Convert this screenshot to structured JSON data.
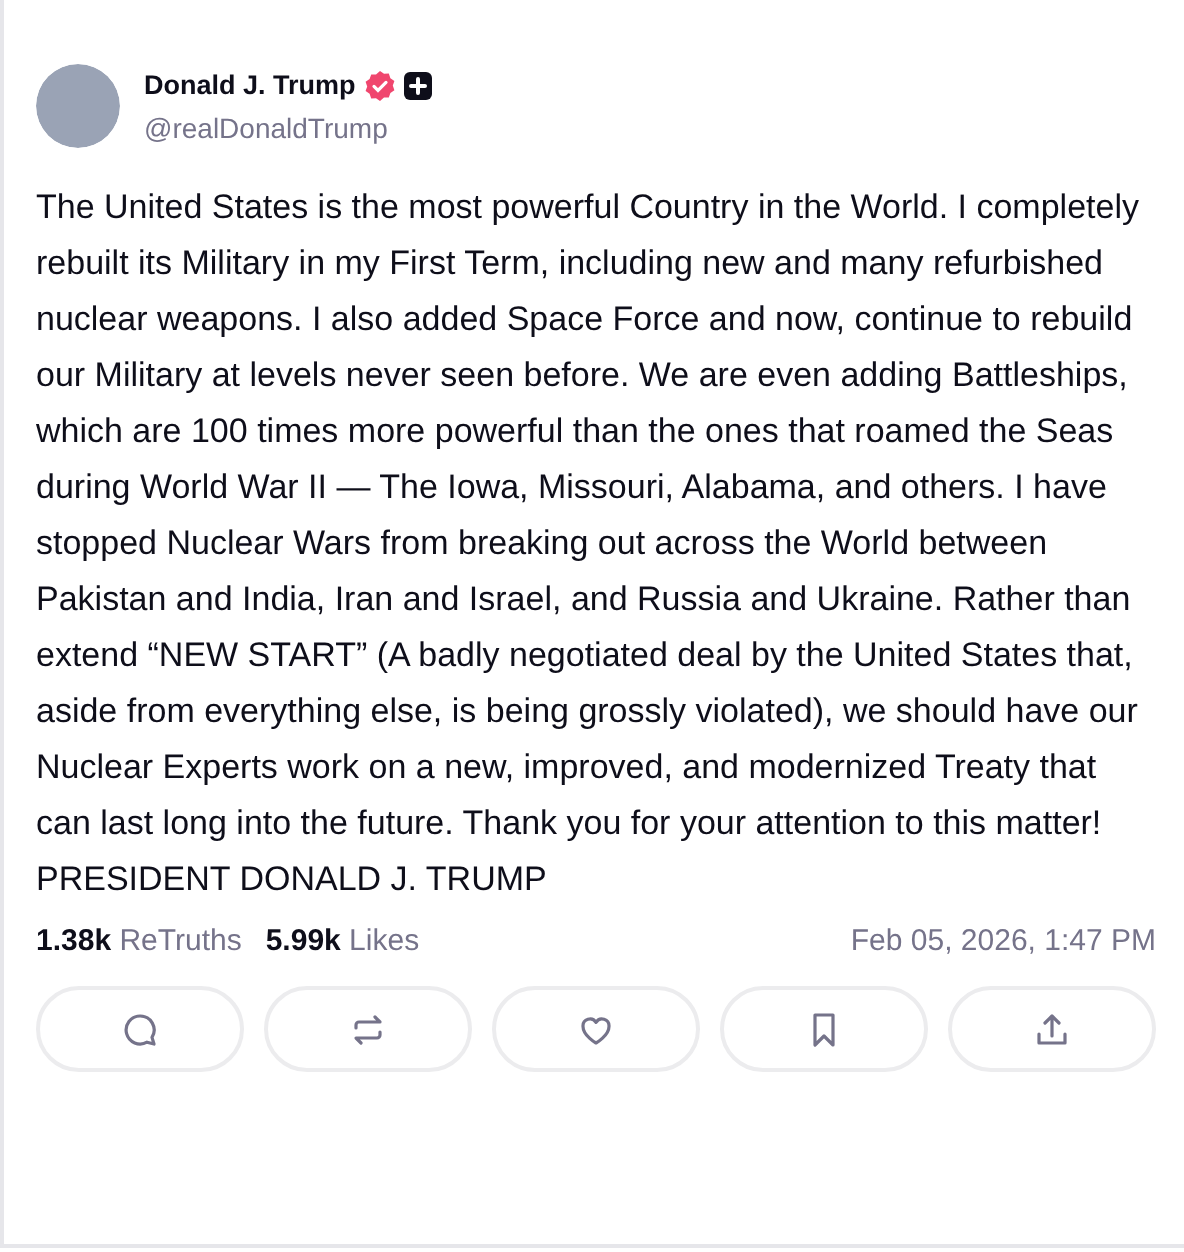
{
  "author": {
    "name": "Donald J. Trump",
    "handle": "@realDonaldTrump",
    "verified": true,
    "premium": true
  },
  "body": "The United States is the most powerful Country in the World. I completely rebuilt its Military in my First Term, including new and many refurbished nuclear weapons. I also added Space Force and now, continue to rebuild our Military at levels never seen before. We are even adding Battleships, which are 100 times more powerful than the ones that roamed the Seas during World War II — The Iowa, Missouri, Alabama, and others. I have stopped Nuclear Wars from breaking out across the World between Pakistan and India, Iran and Israel, and Russia and Ukraine. Rather than extend “NEW START” (A badly negotiated deal by the United States that, aside from everything else, is being grossly violated), we should have our Nuclear Experts work on a new, improved, and modernized Treaty that can last long into the future. Thank you for your attention to this matter! PRESIDENT DONALD J. TRUMP",
  "stats": [
    {
      "count": "1.38k",
      "label": "ReTruths"
    },
    {
      "count": "5.99k",
      "label": "Likes"
    }
  ],
  "timestamp": "Feb 05, 2026, 1:47 PM",
  "actions": [
    {
      "kind": "reply"
    },
    {
      "kind": "retruth"
    },
    {
      "kind": "like"
    },
    {
      "kind": "bookmark"
    },
    {
      "kind": "share"
    }
  ]
}
